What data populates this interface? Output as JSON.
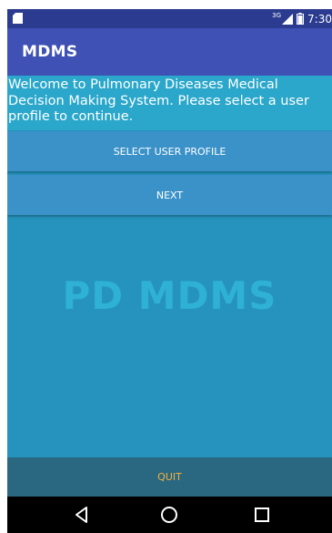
{
  "status_bar": {
    "network_label": "3G",
    "time": "7:30"
  },
  "app_bar": {
    "title": "MDMS"
  },
  "welcome": {
    "message": "Welcome to Pulmonary Diseases Medical Decision Making System. Please select a user profile to continue."
  },
  "buttons": {
    "select_profile": "SELECT USER PROFILE",
    "next": "NEXT",
    "quit": "QUIT"
  },
  "watermark": {
    "text": "PD MDMS"
  },
  "colors": {
    "status_bar": "#2b3b8f",
    "app_bar": "#3f51b5",
    "background": "#2593bd",
    "welcome_bg": "#2aa7cb",
    "button_bg": "#3b92c9",
    "watermark": "#2fb0d5",
    "quit_bg": "#2a6781",
    "quit_text": "#f4b23b"
  },
  "icons": {
    "status_left": "sd-card-icon",
    "signal": "signal-icon",
    "battery": "battery-icon",
    "nav_back": "back-icon",
    "nav_home": "home-icon",
    "nav_recent": "recent-apps-icon"
  }
}
